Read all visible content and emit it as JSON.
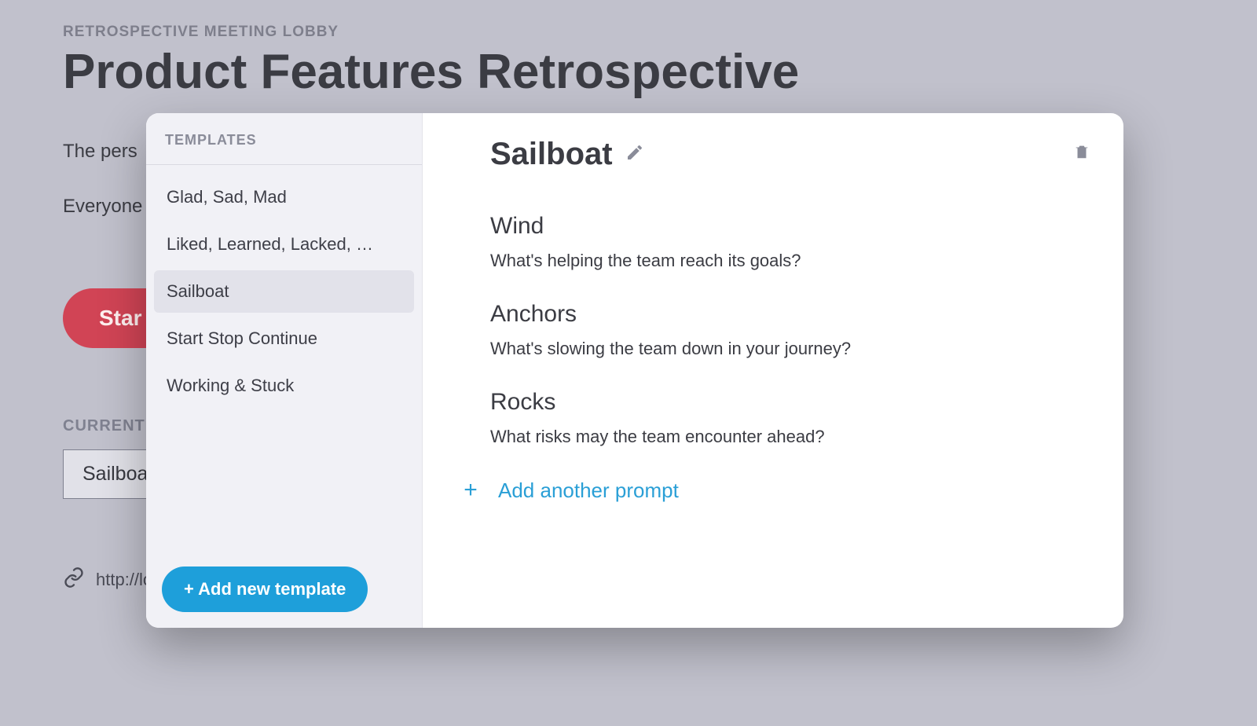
{
  "page": {
    "eyebrow": "RETROSPECTIVE MEETING LOBBY",
    "title": "Product Features Retrospective",
    "sub1": "The pers",
    "sub2": "Everyone",
    "start_label": "Star",
    "current_label": "CURRENT",
    "current_value": "Sailboa",
    "link_url": "http://loca"
  },
  "modal": {
    "sidebar": {
      "header": "TEMPLATES",
      "items": [
        "Glad, Sad, Mad",
        "Liked, Learned, Lacked, …",
        "Sailboat",
        "Start Stop Continue",
        "Working & Stuck"
      ],
      "selected_index": 2,
      "add_button": "+ Add new template"
    },
    "detail": {
      "name": "Sailboat",
      "prompts": [
        {
          "title": "Wind",
          "desc": "What's helping the team reach its goals?"
        },
        {
          "title": "Anchors",
          "desc": "What's slowing the team down in your journey?"
        },
        {
          "title": "Rocks",
          "desc": "What risks may the team encounter ahead?"
        }
      ],
      "add_prompt_label": "Add another prompt"
    }
  }
}
